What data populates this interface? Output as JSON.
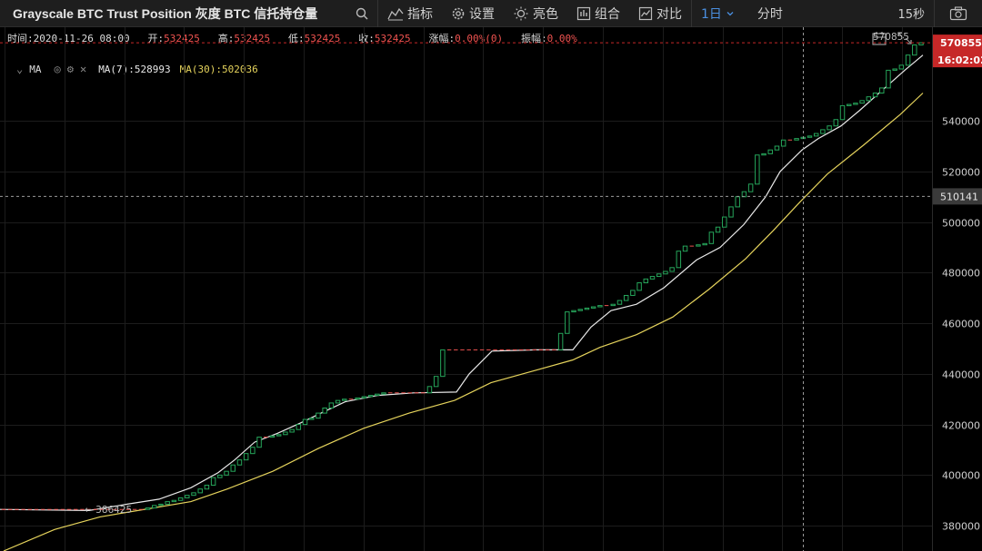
{
  "toolbar": {
    "symbol": "Grayscale BTC Trust Position 灰度 BTC 信托持仓量",
    "indicators_label": "指标",
    "settings_label": "设置",
    "theme_label": "亮色",
    "compose_label": "组合",
    "compare_label": "对比",
    "interval_day": "1日",
    "interval_minute": "分时",
    "refresh": "15秒"
  },
  "info": {
    "time_label": "时间:",
    "time": "2020-11-26 08:00",
    "open_label": "开:",
    "open": "532425",
    "high_label": "高:",
    "high": "532425",
    "low_label": "低:",
    "low": "532425",
    "close_label": "收:",
    "close": "532425",
    "change_label": "涨幅:",
    "change": "0.00%(0)",
    "amplitude_label": "振幅:",
    "amplitude": "0.00%"
  },
  "ma_legend": {
    "name": "MA",
    "ma7": "MA(7):528993",
    "ma30": "MA(30):502036"
  },
  "colors": {
    "up": "#26a65b",
    "down": "#ef5350",
    "ma7": "#e8e8e8",
    "ma30": "#e5d35c",
    "price_tag": "#c62828",
    "crosshair_tag": "#3a3a3a"
  },
  "chart_data": {
    "type": "candlestick",
    "y_ticks": [
      380000,
      400000,
      420000,
      440000,
      460000,
      480000,
      500000,
      520000,
      540000
    ],
    "ylim": [
      370000,
      577000
    ],
    "last_price": 570855,
    "last_price_label": "570855",
    "countdown": "16:02:02",
    "crosshair_value": 510141,
    "crosshair_label": "510141",
    "min_label": "386425",
    "grid": true,
    "candles": [
      {
        "o": 386425,
        "c": 386425
      },
      {
        "o": 386425,
        "c": 386425
      },
      {
        "o": 386425,
        "c": 386425
      },
      {
        "o": 386425,
        "c": 386425
      },
      {
        "o": 386425,
        "c": 386425
      },
      {
        "o": 386425,
        "c": 386425
      },
      {
        "o": 386425,
        "c": 386425
      },
      {
        "o": 386425,
        "c": 386425
      },
      {
        "o": 386425,
        "c": 386425
      },
      {
        "o": 386425,
        "c": 386425
      },
      {
        "o": 386425,
        "c": 386425
      },
      {
        "o": 386425,
        "c": 386425
      },
      {
        "o": 386425,
        "c": 386425
      },
      {
        "o": 386425,
        "c": 386425
      },
      {
        "o": 386425,
        "c": 386425
      },
      {
        "o": 386425,
        "c": 386425
      },
      {
        "o": 386425,
        "c": 386425
      },
      {
        "o": 386425,
        "c": 386425
      },
      {
        "o": 386425,
        "c": 386425
      },
      {
        "o": 386425,
        "c": 386425
      },
      {
        "o": 386425,
        "c": 386425
      },
      {
        "o": 386425,
        "c": 386425
      },
      {
        "o": 386425,
        "c": 387000
      },
      {
        "o": 387000,
        "c": 388000
      },
      {
        "o": 388000,
        "c": 388500
      },
      {
        "o": 388500,
        "c": 389500
      },
      {
        "o": 389500,
        "c": 390000
      },
      {
        "o": 390000,
        "c": 391000
      },
      {
        "o": 391000,
        "c": 392000
      },
      {
        "o": 392000,
        "c": 393000
      },
      {
        "o": 393000,
        "c": 394500
      },
      {
        "o": 394500,
        "c": 396000
      },
      {
        "o": 396000,
        "c": 399000
      },
      {
        "o": 399000,
        "c": 400000
      },
      {
        "o": 400000,
        "c": 401500
      },
      {
        "o": 401500,
        "c": 404000
      },
      {
        "o": 404000,
        "c": 406000
      },
      {
        "o": 406000,
        "c": 408500
      },
      {
        "o": 408500,
        "c": 411000
      },
      {
        "o": 411000,
        "c": 415000
      },
      {
        "o": 415000,
        "c": 415000
      },
      {
        "o": 415000,
        "c": 415500
      },
      {
        "o": 415500,
        "c": 416000
      },
      {
        "o": 416000,
        "c": 417000
      },
      {
        "o": 417000,
        "c": 418000
      },
      {
        "o": 418000,
        "c": 420000
      },
      {
        "o": 420000,
        "c": 422000
      },
      {
        "o": 422000,
        "c": 422500
      },
      {
        "o": 422500,
        "c": 424500
      },
      {
        "o": 424500,
        "c": 426500
      },
      {
        "o": 426500,
        "c": 428500
      },
      {
        "o": 428500,
        "c": 429500
      },
      {
        "o": 429500,
        "c": 430000
      },
      {
        "o": 430000,
        "c": 430000
      },
      {
        "o": 430000,
        "c": 430500
      },
      {
        "o": 430500,
        "c": 431000
      },
      {
        "o": 431000,
        "c": 431500
      },
      {
        "o": 431500,
        "c": 432000
      },
      {
        "o": 432000,
        "c": 432500
      },
      {
        "o": 432500,
        "c": 432500
      },
      {
        "o": 432500,
        "c": 432500
      },
      {
        "o": 432500,
        "c": 432500
      },
      {
        "o": 432500,
        "c": 432500
      },
      {
        "o": 432500,
        "c": 432500
      },
      {
        "o": 432500,
        "c": 432500
      },
      {
        "o": 432500,
        "c": 435000
      },
      {
        "o": 435000,
        "c": 439000
      },
      {
        "o": 439000,
        "c": 449500
      },
      {
        "o": 449500,
        "c": 449500
      },
      {
        "o": 449500,
        "c": 449500
      },
      {
        "o": 449500,
        "c": 449500
      },
      {
        "o": 449500,
        "c": 449500
      },
      {
        "o": 449500,
        "c": 449500
      },
      {
        "o": 449500,
        "c": 449500
      },
      {
        "o": 449500,
        "c": 449500
      },
      {
        "o": 449500,
        "c": 449500
      },
      {
        "o": 449500,
        "c": 449500
      },
      {
        "o": 449500,
        "c": 449500
      },
      {
        "o": 449500,
        "c": 449500
      },
      {
        "o": 449500,
        "c": 449500
      },
      {
        "o": 449500,
        "c": 449500
      },
      {
        "o": 449500,
        "c": 449500
      },
      {
        "o": 449500,
        "c": 449500
      },
      {
        "o": 449500,
        "c": 449500
      },
      {
        "o": 449500,
        "c": 449500
      },
      {
        "o": 449500,
        "c": 456000
      },
      {
        "o": 456000,
        "c": 464500
      },
      {
        "o": 464500,
        "c": 465000
      },
      {
        "o": 465000,
        "c": 465500
      },
      {
        "o": 465500,
        "c": 466000
      },
      {
        "o": 466000,
        "c": 466500
      },
      {
        "o": 466500,
        "c": 467000
      },
      {
        "o": 467000,
        "c": 467000
      },
      {
        "o": 467000,
        "c": 467500
      },
      {
        "o": 467500,
        "c": 469000
      },
      {
        "o": 469000,
        "c": 471000
      },
      {
        "o": 471000,
        "c": 473000
      },
      {
        "o": 473000,
        "c": 476000
      },
      {
        "o": 476000,
        "c": 477500
      },
      {
        "o": 477500,
        "c": 478500
      },
      {
        "o": 478500,
        "c": 479500
      },
      {
        "o": 479500,
        "c": 480500
      },
      {
        "o": 480500,
        "c": 482000
      },
      {
        "o": 482000,
        "c": 488500
      },
      {
        "o": 488500,
        "c": 490500
      },
      {
        "o": 490500,
        "c": 490500
      },
      {
        "o": 490500,
        "c": 491000
      },
      {
        "o": 491000,
        "c": 491500
      },
      {
        "o": 491500,
        "c": 496000
      },
      {
        "o": 496000,
        "c": 498000
      },
      {
        "o": 498000,
        "c": 502000
      },
      {
        "o": 502000,
        "c": 506000
      },
      {
        "o": 506000,
        "c": 510000
      },
      {
        "o": 510000,
        "c": 512000
      },
      {
        "o": 512000,
        "c": 515000
      },
      {
        "o": 515000,
        "c": 526500
      },
      {
        "o": 526500,
        "c": 527000
      },
      {
        "o": 527000,
        "c": 528500
      },
      {
        "o": 528500,
        "c": 530000
      },
      {
        "o": 530000,
        "c": 532425
      },
      {
        "o": 532425,
        "c": 532425
      },
      {
        "o": 532425,
        "c": 533000
      },
      {
        "o": 533000,
        "c": 533500
      },
      {
        "o": 533500,
        "c": 534000
      },
      {
        "o": 534000,
        "c": 535000
      },
      {
        "o": 535000,
        "c": 536500
      },
      {
        "o": 536500,
        "c": 538000
      },
      {
        "o": 538000,
        "c": 540500
      },
      {
        "o": 540500,
        "c": 546000
      },
      {
        "o": 546000,
        "c": 546500
      },
      {
        "o": 546500,
        "c": 547000
      },
      {
        "o": 547000,
        "c": 548000
      },
      {
        "o": 548000,
        "c": 549500
      },
      {
        "o": 549500,
        "c": 551000
      },
      {
        "o": 551000,
        "c": 553000
      },
      {
        "o": 553000,
        "c": 560000
      },
      {
        "o": 560000,
        "c": 560500
      },
      {
        "o": 560500,
        "c": 562000
      },
      {
        "o": 562000,
        "c": 566000
      },
      {
        "o": 566000,
        "c": 570000
      },
      {
        "o": 570000,
        "c": 570855
      }
    ],
    "ma7": [
      [
        0,
        386425
      ],
      [
        98,
        386000
      ],
      [
        140,
        388500
      ],
      [
        175,
        390500
      ],
      [
        210,
        395000
      ],
      [
        240,
        401000
      ],
      [
        258,
        406000
      ],
      [
        280,
        413000
      ],
      [
        305,
        416500
      ],
      [
        330,
        420500
      ],
      [
        356,
        425000
      ],
      [
        380,
        429000
      ],
      [
        415,
        431500
      ],
      [
        455,
        432500
      ],
      [
        502,
        432800
      ],
      [
        516,
        440000
      ],
      [
        541,
        449000
      ],
      [
        590,
        449500
      ],
      [
        630,
        449500
      ],
      [
        650,
        458500
      ],
      [
        672,
        465000
      ],
      [
        700,
        467500
      ],
      [
        730,
        474000
      ],
      [
        766,
        485000
      ],
      [
        792,
        490000
      ],
      [
        818,
        499000
      ],
      [
        842,
        510000
      ],
      [
        858,
        520000
      ],
      [
        882,
        528500
      ],
      [
        900,
        533000
      ],
      [
        925,
        538000
      ],
      [
        945,
        544000
      ],
      [
        970,
        552000
      ],
      [
        995,
        560000
      ],
      [
        1015,
        566000
      ]
    ],
    "ma30": [
      [
        4,
        370000
      ],
      [
        60,
        378500
      ],
      [
        110,
        383500
      ],
      [
        160,
        386500
      ],
      [
        210,
        389500
      ],
      [
        250,
        394500
      ],
      [
        300,
        401500
      ],
      [
        350,
        410500
      ],
      [
        400,
        418500
      ],
      [
        450,
        424500
      ],
      [
        500,
        429500
      ],
      [
        540,
        436500
      ],
      [
        590,
        441500
      ],
      [
        630,
        445500
      ],
      [
        660,
        450500
      ],
      [
        700,
        455500
      ],
      [
        740,
        462500
      ],
      [
        780,
        473500
      ],
      [
        820,
        485500
      ],
      [
        850,
        496500
      ],
      [
        880,
        508000
      ],
      [
        910,
        519000
      ],
      [
        950,
        530500
      ],
      [
        990,
        542500
      ],
      [
        1015,
        551000
      ]
    ]
  }
}
